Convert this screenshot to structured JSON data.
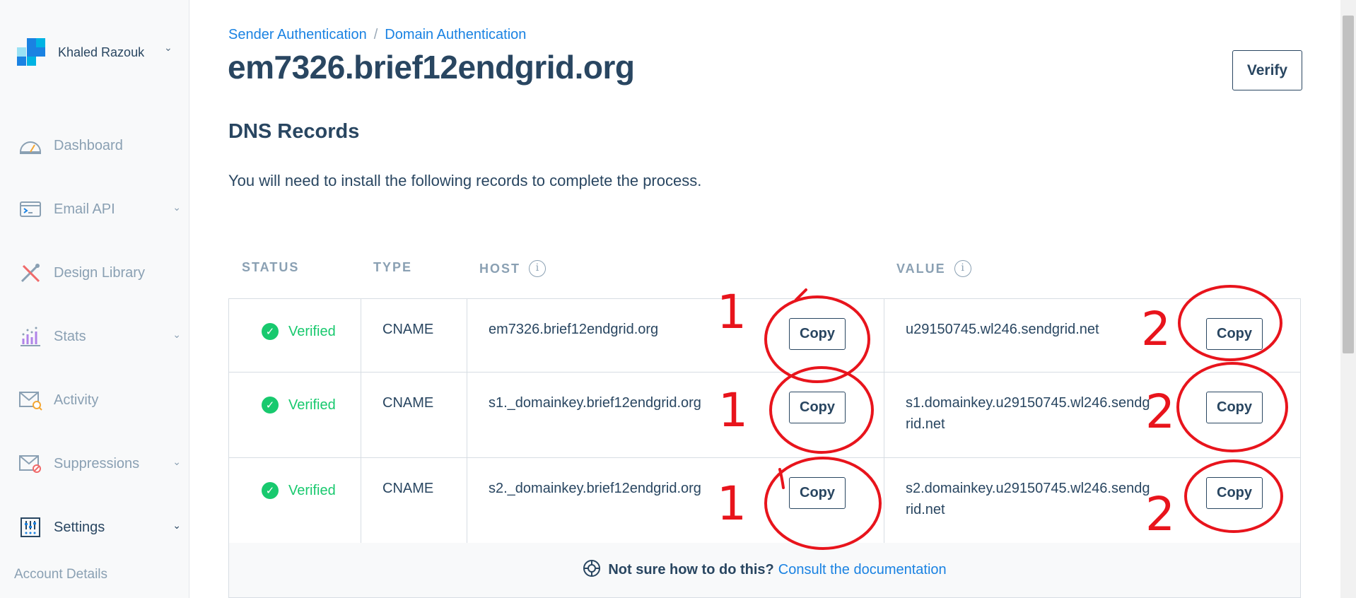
{
  "colors": {
    "accent": "#1a82e2",
    "verified": "#18c96e",
    "text": "#294661",
    "muted": "#8aa0b3",
    "annotation": "#e8141c"
  },
  "sidebar": {
    "account_name": "Khaled Razouk",
    "items": [
      {
        "label": "Dashboard",
        "icon": "gauge-icon",
        "has_children": false
      },
      {
        "label": "Email API",
        "icon": "terminal-icon",
        "has_children": true
      },
      {
        "label": "Design Library",
        "icon": "pencil-ruler-icon",
        "has_children": false
      },
      {
        "label": "Stats",
        "icon": "stats-icon",
        "has_children": true
      },
      {
        "label": "Activity",
        "icon": "envelope-search-icon",
        "has_children": false
      },
      {
        "label": "Suppressions",
        "icon": "envelope-block-icon",
        "has_children": true
      },
      {
        "label": "Settings",
        "icon": "sliders-icon",
        "has_children": true
      }
    ],
    "sub_item": "Account Details"
  },
  "breadcrumb": {
    "parent": "Sender Authentication",
    "current": "Domain Authentication",
    "separator": "/"
  },
  "page_title": "em7326.brief12endgrid.org",
  "verify_label": "Verify",
  "dns": {
    "title": "DNS Records",
    "intro": "You will need to install the following records to complete the process.",
    "columns": {
      "status": "STATUS",
      "type": "TYPE",
      "host": "HOST",
      "value": "VALUE"
    },
    "copy_label": "Copy",
    "records": [
      {
        "status": "Verified",
        "type": "CNAME",
        "host": "em7326.brief12endgrid.org",
        "value": "u29150745.wl246.sendgrid.net"
      },
      {
        "status": "Verified",
        "type": "CNAME",
        "host": "s1._domainkey.brief12endgrid.org",
        "value_line1": "s1.domainkey.u29150745.wl246.sendg",
        "value_line2": "rid.net"
      },
      {
        "status": "Verified",
        "type": "CNAME",
        "host": "s2._domainkey.brief12endgrid.org",
        "value_line1": "s2.domainkey.u29150745.wl246.sendg",
        "value_line2": "rid.net"
      }
    ]
  },
  "help": {
    "question": "Not sure how to do this?",
    "link": "Consult the documentation"
  },
  "annotations": {
    "left_number": "1",
    "right_number": "2"
  }
}
